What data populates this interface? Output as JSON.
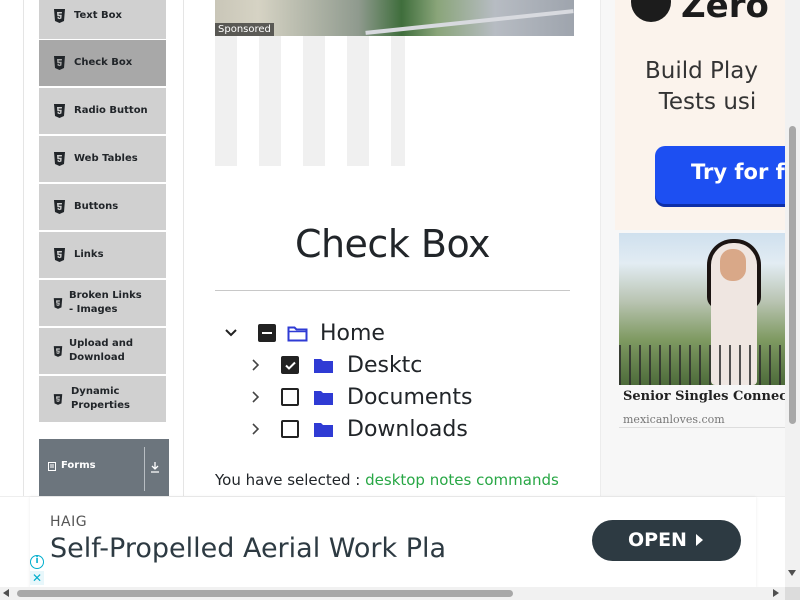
{
  "sidebar": {
    "items": [
      {
        "label": "Text Box",
        "icon": "html5-icon"
      },
      {
        "label": "Check Box",
        "icon": "html5-icon",
        "active": true
      },
      {
        "label": "Radio Button",
        "icon": "html5-icon"
      },
      {
        "label": "Web Tables",
        "icon": "html5-icon"
      },
      {
        "label": "Buttons",
        "icon": "html5-icon"
      },
      {
        "label": "Links",
        "icon": "html5-icon"
      },
      {
        "label": "Broken Links - Images",
        "icon": "html5-icon"
      },
      {
        "label": "Upload and Download",
        "icon": "html5-icon"
      },
      {
        "label": "Dynamic Properties",
        "icon": "html5-icon"
      }
    ],
    "group": {
      "label": "Forms",
      "icon": "form-icon",
      "toggle_icon": "download-arrow-icon"
    }
  },
  "sponsored": {
    "tag": "Sponsored"
  },
  "main": {
    "title": "Check Box",
    "tree": [
      {
        "label": "Home",
        "level": 0,
        "state": "indeterminate",
        "expanded": true,
        "folder": "folder-open-icon"
      },
      {
        "label": "Desktc",
        "level": 1,
        "state": "checked",
        "expanded": false,
        "folder": "folder-icon"
      },
      {
        "label": "Documents",
        "level": 1,
        "state": "unchecked",
        "expanded": false,
        "folder": "folder-icon"
      },
      {
        "label": "Downloads",
        "level": 1,
        "state": "unchecked",
        "expanded": false,
        "folder": "folder-icon"
      }
    ],
    "selected_prefix": "You have selected :",
    "selected_values": "desktop notes commands"
  },
  "right_ad": {
    "brand": "Zero",
    "headline_1": "Build Play",
    "headline_2": "Tests usi",
    "cta": "Try for fr",
    "singles_title": "Senior Singles Connection",
    "singles_domain": "mexicanloves.com"
  },
  "banner": {
    "brand": "HAIG",
    "headline": "Self-Propelled Aerial Work Pla",
    "cta": "OPEN",
    "adchoice": "i",
    "close": "✕"
  },
  "colors": {
    "sidebar_bg": "#d0d0d0",
    "sidebar_active": "#a8a8a8",
    "forms_group": "#6c757d",
    "folder_blue": "#2f3bd4",
    "selected_green": "#28a745",
    "cta_blue": "#1d4ff2",
    "banner_button": "#2d3a42"
  }
}
